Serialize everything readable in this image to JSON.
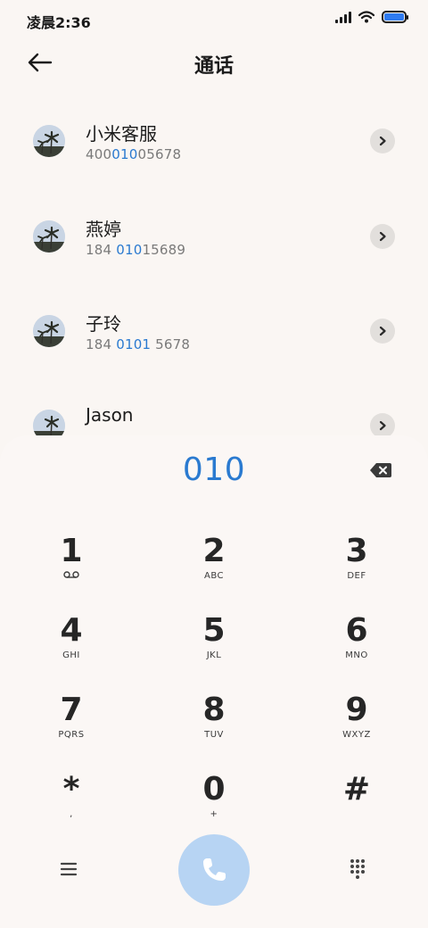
{
  "status_bar": {
    "time": "凌晨2:36",
    "battery_color": "#2f7bf0"
  },
  "header": {
    "title": "通话",
    "back_icon": "arrow-left-icon"
  },
  "contacts": [
    {
      "name": "小米客服",
      "number_parts": [
        "400",
        "010",
        "05678"
      ]
    },
    {
      "name": "燕婷",
      "number_parts": [
        "184 ",
        "010",
        "15689"
      ]
    },
    {
      "name": "子玲",
      "number_parts": [
        "184 ",
        "0101",
        " 5678"
      ]
    },
    {
      "name": "Jason",
      "number_parts": [
        "",
        "",
        ""
      ]
    }
  ],
  "dialer": {
    "input_value": "010",
    "accent_color": "#2a7ad0",
    "backspace_icon": "backspace-icon",
    "keys": [
      {
        "digit": "1",
        "letters": "",
        "icon": "voicemail-icon"
      },
      {
        "digit": "2",
        "letters": "ABC"
      },
      {
        "digit": "3",
        "letters": "DEF"
      },
      {
        "digit": "4",
        "letters": "GHI"
      },
      {
        "digit": "5",
        "letters": "JKL"
      },
      {
        "digit": "6",
        "letters": "MNO"
      },
      {
        "digit": "7",
        "letters": "PQRS"
      },
      {
        "digit": "8",
        "letters": "TUV"
      },
      {
        "digit": "9",
        "letters": "WXYZ"
      },
      {
        "digit": "*",
        "letters": ","
      },
      {
        "digit": "0",
        "letters": "+"
      },
      {
        "digit": "#",
        "letters": ""
      }
    ],
    "bottom_icons": [
      "menu-icon",
      "phone-call-icon",
      "keypad-icon"
    ]
  }
}
